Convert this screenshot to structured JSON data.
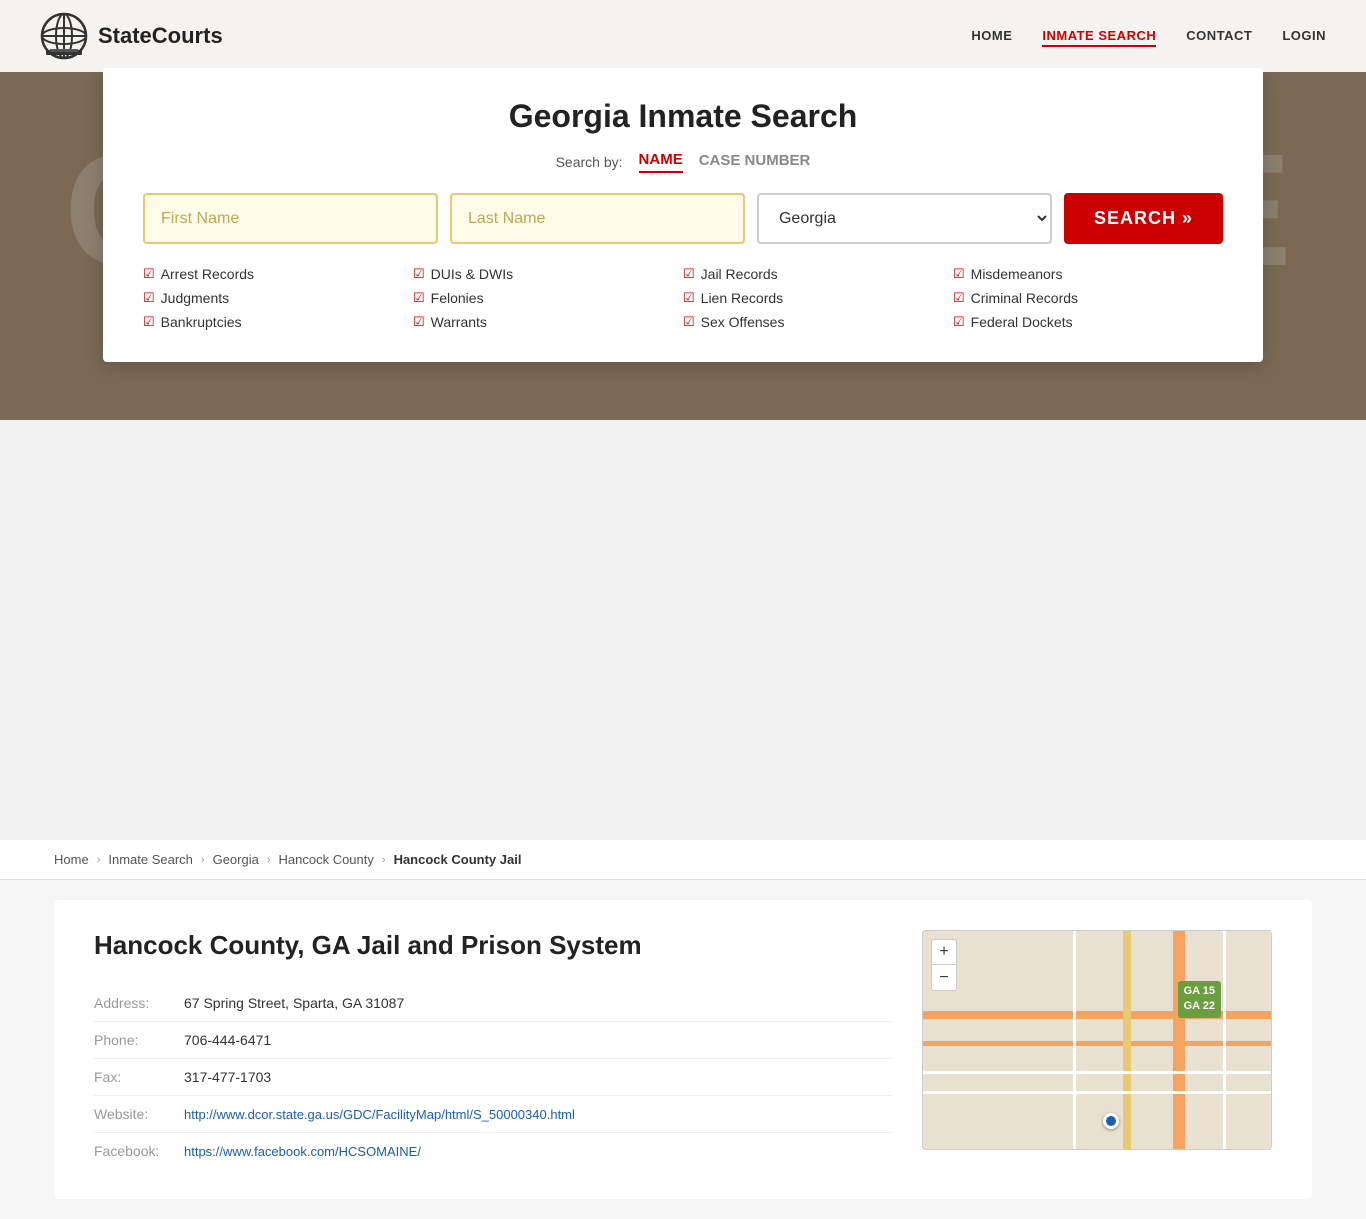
{
  "site": {
    "logo_text": "StateCourts",
    "bg_text": "COURTHOUSE"
  },
  "nav": {
    "home_label": "HOME",
    "inmate_search_label": "INMATE SEARCH",
    "contact_label": "CONTACT",
    "login_label": "LOGIN"
  },
  "search_card": {
    "title": "Georgia Inmate Search",
    "search_by_label": "Search by:",
    "tab_name": "NAME",
    "tab_case": "CASE NUMBER",
    "first_name_placeholder": "First Name",
    "last_name_placeholder": "Last Name",
    "state_default": "Georgia",
    "search_button": "SEARCH »",
    "features": [
      "Arrest Records",
      "Judgments",
      "Bankruptcies",
      "DUIs & DWIs",
      "Felonies",
      "Warrants",
      "Jail Records",
      "Lien Records",
      "Sex Offenses",
      "Misdemeanors",
      "Criminal Records",
      "Federal Dockets"
    ]
  },
  "breadcrumb": {
    "home": "Home",
    "inmate_search": "Inmate Search",
    "georgia": "Georgia",
    "county": "Hancock County",
    "current": "Hancock County Jail"
  },
  "facility": {
    "title": "Hancock County, GA Jail and Prison System",
    "address_label": "Address:",
    "address_value": "67 Spring Street, Sparta, GA 31087",
    "phone_label": "Phone:",
    "phone_value": "706-444-6471",
    "fax_label": "Fax:",
    "fax_value": "317-477-1703",
    "website_label": "Website:",
    "website_url": "http://www.dcor.state.ga.us/GDC/FacilityMap/html/S_50000340.html",
    "website_text": "http://www.dcor.state.ga.us/GDC/FacilityMap/html/S_50000340.html",
    "facebook_label": "Facebook:",
    "facebook_url": "https://www.facebook.com/HCSOMAINE/",
    "facebook_text": "https://www.facebook.com/HCSOMAINE/"
  },
  "map": {
    "zoom_in": "+",
    "zoom_out": "−",
    "sign1": "GA 15\nGA 22"
  }
}
